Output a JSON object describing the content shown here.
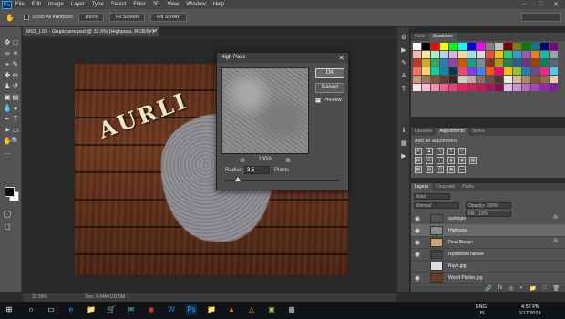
{
  "menubar": {
    "logo": "Ps",
    "items": [
      "File",
      "Edit",
      "Image",
      "Layer",
      "Type",
      "Select",
      "Filter",
      "3D",
      "View",
      "Window",
      "Help"
    ]
  },
  "options": {
    "scroll_all_windows": "Scroll All Windows",
    "zoom_value": "100%",
    "fit_screen": "Fit Screen",
    "fill_screen": "Fill Screen"
  },
  "document": {
    "tab_title": "M03_L03 - Grupiciane.psd @ 32.6% (Highpass, RGB/8#) *",
    "artwork_text": "AURLI",
    "status_zoom": "32.55%",
    "status_doc": "Doc: 6.94M/102.5M"
  },
  "dialog": {
    "title": "High Pass",
    "ok": "OK",
    "cancel": "Cancel",
    "preview_label": "Preview",
    "preview_checked": true,
    "zoom_percent": "100%",
    "radius_label": "Radius:",
    "radius_value": "3.5",
    "radius_unit": "Pixels",
    "radius_slider_fraction": 0.11
  },
  "panels": {
    "color_tabs": [
      "Color",
      "Swatches"
    ],
    "adjust_tabs": [
      "Libraries",
      "Adjustments",
      "Styles"
    ],
    "adjust_title": "Add an adjustment",
    "layers_tabs": [
      "Layers",
      "Channels",
      "Paths"
    ],
    "layers_filter": "Kind",
    "blend_mode": "Normal",
    "opacity": "Opacity: 100%",
    "fill": "Fill: 100%",
    "layers": [
      {
        "name": "aurlinger",
        "selected": false,
        "fx": true,
        "visible": true,
        "thumb": "#555555"
      },
      {
        "name": "Highpass",
        "selected": true,
        "fx": false,
        "visible": true,
        "thumb": "#8a8a8a"
      },
      {
        "name": "Final Burger",
        "selected": false,
        "fx": true,
        "visible": true,
        "thumb": "#c9a46a"
      },
      {
        "name": "Izpabtosni fakove",
        "selected": false,
        "fx": false,
        "visible": true,
        "thumb": "#444444"
      },
      {
        "name": "Rays.jpg",
        "selected": false,
        "fx": false,
        "visible": false,
        "thumb": "#dddddd"
      },
      {
        "name": "Wood Planks.jpg",
        "selected": false,
        "fx": false,
        "visible": true,
        "thumb": "#6b3a20"
      }
    ]
  },
  "swatch_colors": [
    "#ffffff",
    "#000000",
    "#ff0000",
    "#ffff00",
    "#00ff00",
    "#00ffff",
    "#0000ff",
    "#ff00ff",
    "#808080",
    "#c0c0c0",
    "#800000",
    "#808000",
    "#008000",
    "#008080",
    "#000080",
    "#800080",
    "#f5b7b1",
    "#f9e79f",
    "#abebc6",
    "#aed6f1",
    "#d2b4de",
    "#fad7a0",
    "#a3e4d7",
    "#d5dbdb",
    "#e74c3c",
    "#f1c40f",
    "#2ecc71",
    "#3498db",
    "#9b59b6",
    "#e67e22",
    "#1abc9c",
    "#95a5a6",
    "#c0392b",
    "#d4ac0d",
    "#27ae60",
    "#2980b9",
    "#8e44ad",
    "#d35400",
    "#16a085",
    "#7f8c8d",
    "#922b21",
    "#b7950b",
    "#1e8449",
    "#1f618d",
    "#6c3483",
    "#a04000",
    "#117a65",
    "#566573",
    "#ff6f61",
    "#ffd166",
    "#06d6a0",
    "#118ab2",
    "#073b4c",
    "#ef476f",
    "#8338ec",
    "#3a86ff",
    "#fb5607",
    "#ff006e",
    "#ffbe0b",
    "#8ac926",
    "#1982c4",
    "#6a4c93",
    "#f72585",
    "#4cc9f0",
    "#c49a6c",
    "#a0785a",
    "#7b5b3a",
    "#5c4033",
    "#3e2723",
    "#d7ccc8",
    "#bcaaa4",
    "#8d6e63",
    "#6d4c41",
    "#4e342e",
    "#efebe9",
    "#d7b899",
    "#b08968",
    "#7f5539",
    "#9c6644",
    "#e6ccb2",
    "#fce4ec",
    "#f8bbd0",
    "#f48fb1",
    "#f06292",
    "#ec407a",
    "#e91e63",
    "#d81b60",
    "#c2185b",
    "#ad1457",
    "#880e4f",
    "#e1bee7",
    "#ce93d8",
    "#ba68c8",
    "#ab47bc",
    "#9c27b0",
    "#7b1fa2"
  ],
  "taskbar": {
    "language": "ENG",
    "region": "US",
    "time": "4:52 PM",
    "date": "6/17/2019"
  }
}
